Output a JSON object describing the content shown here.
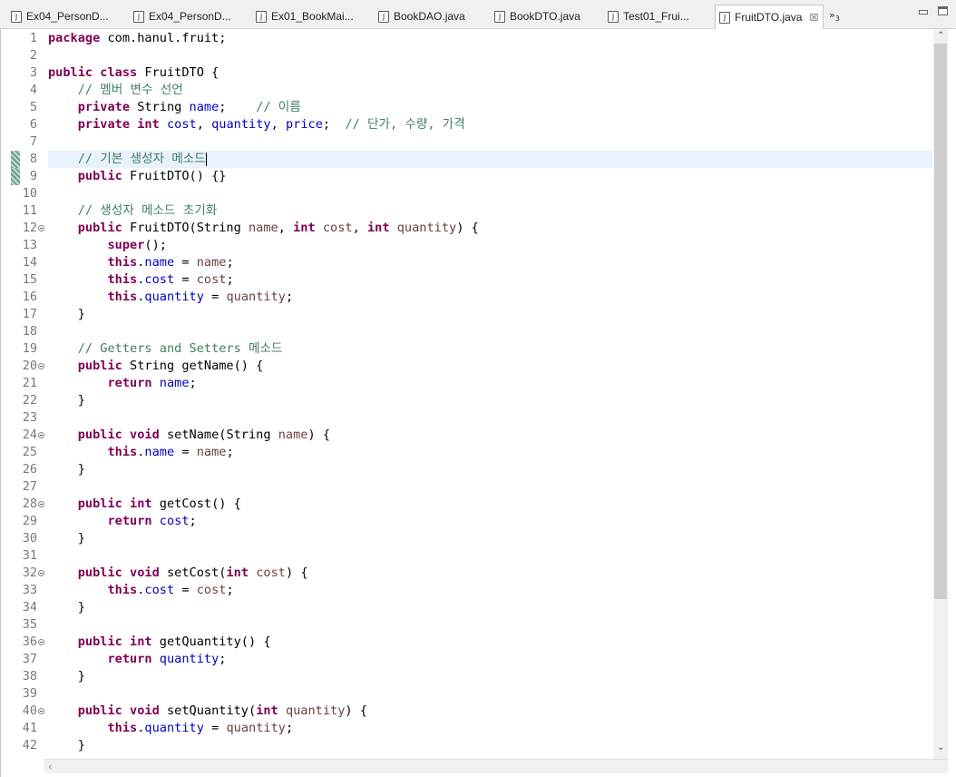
{
  "tabs": [
    {
      "label": "Ex04_PersonD...",
      "active": false
    },
    {
      "label": "Ex04_PersonD...",
      "active": false
    },
    {
      "label": "Ex01_BookMai...",
      "active": false
    },
    {
      "label": "BookDAO.java",
      "active": false
    },
    {
      "label": "BookDTO.java",
      "active": false
    },
    {
      "label": "Test01_Frui...",
      "active": false
    },
    {
      "label": "FruitDTO.java",
      "active": true
    }
  ],
  "tab_icon": "J",
  "tab_close": "☒",
  "overflow": {
    "symbol": "»",
    "count": "3"
  },
  "colors": {
    "keyword": "#7f0055",
    "field": "#0000c0",
    "local": "#6a3e3e",
    "comment": "#3f7f5f",
    "current_line": "#e8f2fe"
  },
  "editor": {
    "current_line": 8,
    "lines": [
      [
        [
          "kw",
          "package"
        ],
        [
          "t",
          " com.hanul.fruit;"
        ]
      ],
      [],
      [
        [
          "kw",
          "public class"
        ],
        [
          "t",
          " FruitDTO {"
        ]
      ],
      [
        [
          "t",
          "    "
        ],
        [
          "cmt",
          "// 멤버 변수 선언"
        ]
      ],
      [
        [
          "t",
          "    "
        ],
        [
          "kw",
          "private"
        ],
        [
          "t",
          " String "
        ],
        [
          "fld",
          "name"
        ],
        [
          "t",
          ";    "
        ],
        [
          "cmt",
          "// 이름"
        ]
      ],
      [
        [
          "t",
          "    "
        ],
        [
          "kw",
          "private int"
        ],
        [
          "t",
          " "
        ],
        [
          "fld",
          "cost"
        ],
        [
          "t",
          ", "
        ],
        [
          "fld",
          "quantity"
        ],
        [
          "t",
          ", "
        ],
        [
          "fld",
          "price"
        ],
        [
          "t",
          ";  "
        ],
        [
          "cmt",
          "// 단가, 수량, 가격"
        ]
      ],
      [],
      [
        [
          "t",
          "    "
        ],
        [
          "cmt",
          "// 기본 생성자 메소드"
        ]
      ],
      [
        [
          "t",
          "    "
        ],
        [
          "kw",
          "public"
        ],
        [
          "t",
          " FruitDTO() {}"
        ]
      ],
      [],
      [
        [
          "t",
          "    "
        ],
        [
          "cmt",
          "// 생성자 메소드 초기화"
        ]
      ],
      [
        [
          "t",
          "    "
        ],
        [
          "kw",
          "public"
        ],
        [
          "t",
          " FruitDTO(String "
        ],
        [
          "var",
          "name"
        ],
        [
          "t",
          ", "
        ],
        [
          "kw",
          "int"
        ],
        [
          "t",
          " "
        ],
        [
          "var",
          "cost"
        ],
        [
          "t",
          ", "
        ],
        [
          "kw",
          "int"
        ],
        [
          "t",
          " "
        ],
        [
          "var",
          "quantity"
        ],
        [
          "t",
          ") {"
        ]
      ],
      [
        [
          "t",
          "        "
        ],
        [
          "kw",
          "super"
        ],
        [
          "t",
          "();"
        ]
      ],
      [
        [
          "t",
          "        "
        ],
        [
          "kw",
          "this"
        ],
        [
          "t",
          "."
        ],
        [
          "fld",
          "name"
        ],
        [
          "t",
          " = "
        ],
        [
          "var",
          "name"
        ],
        [
          "t",
          ";"
        ]
      ],
      [
        [
          "t",
          "        "
        ],
        [
          "kw",
          "this"
        ],
        [
          "t",
          "."
        ],
        [
          "fld",
          "cost"
        ],
        [
          "t",
          " = "
        ],
        [
          "var",
          "cost"
        ],
        [
          "t",
          ";"
        ]
      ],
      [
        [
          "t",
          "        "
        ],
        [
          "kw",
          "this"
        ],
        [
          "t",
          "."
        ],
        [
          "fld",
          "quantity"
        ],
        [
          "t",
          " = "
        ],
        [
          "var",
          "quantity"
        ],
        [
          "t",
          ";"
        ]
      ],
      [
        [
          "t",
          "    }"
        ]
      ],
      [],
      [
        [
          "t",
          "    "
        ],
        [
          "cmt",
          "// Getters and Setters 메소드"
        ]
      ],
      [
        [
          "t",
          "    "
        ],
        [
          "kw",
          "public"
        ],
        [
          "t",
          " String getName() {"
        ]
      ],
      [
        [
          "t",
          "        "
        ],
        [
          "kw",
          "return"
        ],
        [
          "t",
          " "
        ],
        [
          "fld",
          "name"
        ],
        [
          "t",
          ";"
        ]
      ],
      [
        [
          "t",
          "    }"
        ]
      ],
      [],
      [
        [
          "t",
          "    "
        ],
        [
          "kw",
          "public void"
        ],
        [
          "t",
          " setName(String "
        ],
        [
          "var",
          "name"
        ],
        [
          "t",
          ") {"
        ]
      ],
      [
        [
          "t",
          "        "
        ],
        [
          "kw",
          "this"
        ],
        [
          "t",
          "."
        ],
        [
          "fld",
          "name"
        ],
        [
          "t",
          " = "
        ],
        [
          "var",
          "name"
        ],
        [
          "t",
          ";"
        ]
      ],
      [
        [
          "t",
          "    }"
        ]
      ],
      [],
      [
        [
          "t",
          "    "
        ],
        [
          "kw",
          "public int"
        ],
        [
          "t",
          " getCost() {"
        ]
      ],
      [
        [
          "t",
          "        "
        ],
        [
          "kw",
          "return"
        ],
        [
          "t",
          " "
        ],
        [
          "fld",
          "cost"
        ],
        [
          "t",
          ";"
        ]
      ],
      [
        [
          "t",
          "    }"
        ]
      ],
      [],
      [
        [
          "t",
          "    "
        ],
        [
          "kw",
          "public void"
        ],
        [
          "t",
          " setCost("
        ],
        [
          "kw",
          "int"
        ],
        [
          "t",
          " "
        ],
        [
          "var",
          "cost"
        ],
        [
          "t",
          ") {"
        ]
      ],
      [
        [
          "t",
          "        "
        ],
        [
          "kw",
          "this"
        ],
        [
          "t",
          "."
        ],
        [
          "fld",
          "cost"
        ],
        [
          "t",
          " = "
        ],
        [
          "var",
          "cost"
        ],
        [
          "t",
          ";"
        ]
      ],
      [
        [
          "t",
          "    }"
        ]
      ],
      [],
      [
        [
          "t",
          "    "
        ],
        [
          "kw",
          "public int"
        ],
        [
          "t",
          " getQuantity() {"
        ]
      ],
      [
        [
          "t",
          "        "
        ],
        [
          "kw",
          "return"
        ],
        [
          "t",
          " "
        ],
        [
          "fld",
          "quantity"
        ],
        [
          "t",
          ";"
        ]
      ],
      [
        [
          "t",
          "    }"
        ]
      ],
      [],
      [
        [
          "t",
          "    "
        ],
        [
          "kw",
          "public void"
        ],
        [
          "t",
          " setQuantity("
        ],
        [
          "kw",
          "int"
        ],
        [
          "t",
          " "
        ],
        [
          "var",
          "quantity"
        ],
        [
          "t",
          ") {"
        ]
      ],
      [
        [
          "t",
          "        "
        ],
        [
          "kw",
          "this"
        ],
        [
          "t",
          "."
        ],
        [
          "fld",
          "quantity"
        ],
        [
          "t",
          " = "
        ],
        [
          "var",
          "quantity"
        ],
        [
          "t",
          ";"
        ]
      ],
      [
        [
          "t",
          "    }"
        ]
      ]
    ],
    "fold_lines": [
      12,
      20,
      24,
      28,
      32,
      36,
      40
    ],
    "change_marked_lines": [
      8,
      9
    ]
  }
}
